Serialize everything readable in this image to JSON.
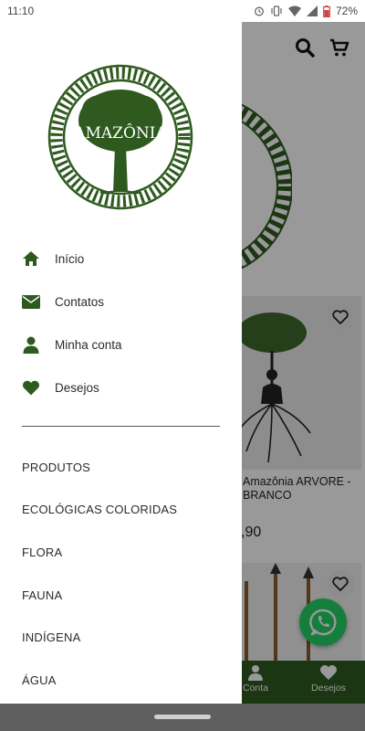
{
  "status_bar": {
    "time": "11:10",
    "battery": "72%"
  },
  "brand": {
    "name": "AMAZÔNIA",
    "green": "#2e5a1f",
    "whatsapp": "#25d366"
  },
  "drawer": {
    "menu": [
      {
        "label": "Início",
        "icon": "home-icon"
      },
      {
        "label": "Contatos",
        "icon": "envelope-icon"
      },
      {
        "label": "Minha conta",
        "icon": "user-icon"
      },
      {
        "label": "Desejos",
        "icon": "heart-icon"
      }
    ],
    "categories": [
      "PRODUTOS",
      "ECOLÓGICAS COLORIDAS",
      "FLORA",
      "FAUNA",
      "INDÍGENA",
      "ÁGUA"
    ]
  },
  "background": {
    "product": {
      "name": "Amazônia ARVORE - BRANCO",
      "price": ",90"
    },
    "bottom_nav": [
      {
        "label": "Conta",
        "icon": "user-icon"
      },
      {
        "label": "Desejos",
        "icon": "heart-icon"
      }
    ]
  }
}
